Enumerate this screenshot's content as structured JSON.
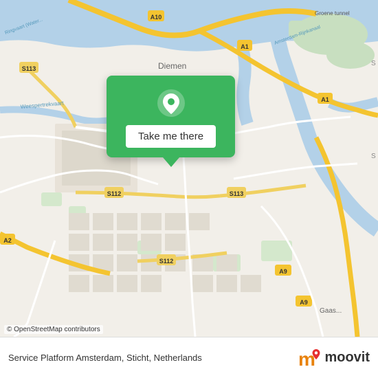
{
  "map": {
    "attribution": "© OpenStreetMap contributors",
    "popup": {
      "button_label": "Take me there"
    }
  },
  "footer": {
    "location_label": "Service Platform Amsterdam, Sticht, Netherlands",
    "osm_credit": "© OpenStreetMap contributors",
    "brand_name": "moovit"
  },
  "icons": {
    "pin": "location-pin-icon",
    "moovit_logo": "moovit-logo-icon"
  }
}
